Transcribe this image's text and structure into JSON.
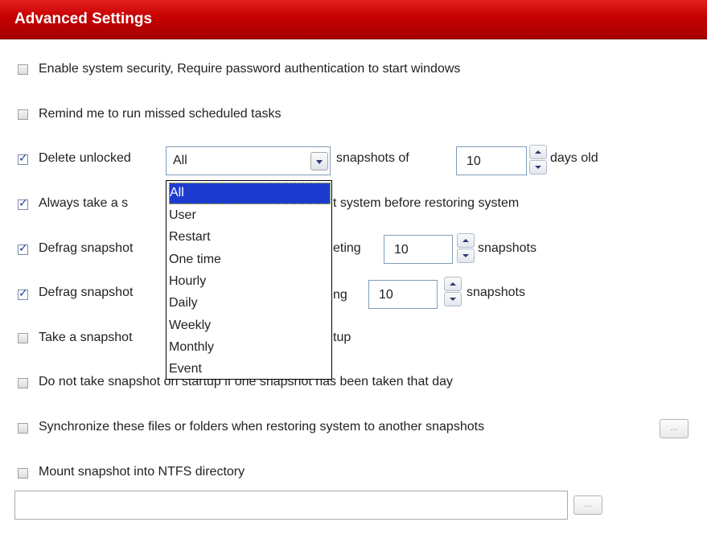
{
  "header": {
    "title": "Advanced Settings"
  },
  "options": {
    "system_security": {
      "label": "Enable system security, Require password authentication to start windows",
      "checked": false
    },
    "remind_missed": {
      "label": "Remind me to run missed scheduled tasks",
      "checked": false
    },
    "delete_unlocked": {
      "label_before": "Delete unlocked",
      "label_middle": "snapshots of",
      "days_value": "10",
      "label_after": "days old",
      "checked": true
    },
    "always_take": {
      "label_visible_left": "Always take a s",
      "label_visible_right": "t system before restoring system",
      "checked": true
    },
    "defrag_1": {
      "label_visible_left": "Defrag snapshot",
      "label_visible_mid": "eting",
      "value": "10",
      "label_after": "snapshots",
      "checked": true
    },
    "defrag_2": {
      "label_visible_left": "Defrag snapshot",
      "label_visible_mid": "ng",
      "value": "10",
      "label_after": "snapshots",
      "checked": true
    },
    "take_startup": {
      "label_visible_left": "Take a snapshot",
      "label_visible_right": "tup",
      "checked": false
    },
    "no_snapshot_startup": {
      "label": "Do not take snapshot on startup if one snapshot has been taken that day",
      "checked": false
    },
    "synchronize": {
      "label": "Synchronize these files or folders when restoring system to another snapshots",
      "checked": false,
      "browse_label": "..."
    },
    "mount": {
      "label": "Mount snapshot into NTFS directory",
      "checked": false,
      "path_value": "",
      "browse_label": "..."
    }
  },
  "snapshot_type_select": {
    "selected": "All",
    "options": [
      "All",
      "User",
      "Restart",
      "One time",
      "Hourly",
      "Daily",
      "Weekly",
      "Monthly",
      "Event"
    ]
  },
  "colors": {
    "header": "#c40000",
    "selection": "#1d3ccf"
  }
}
